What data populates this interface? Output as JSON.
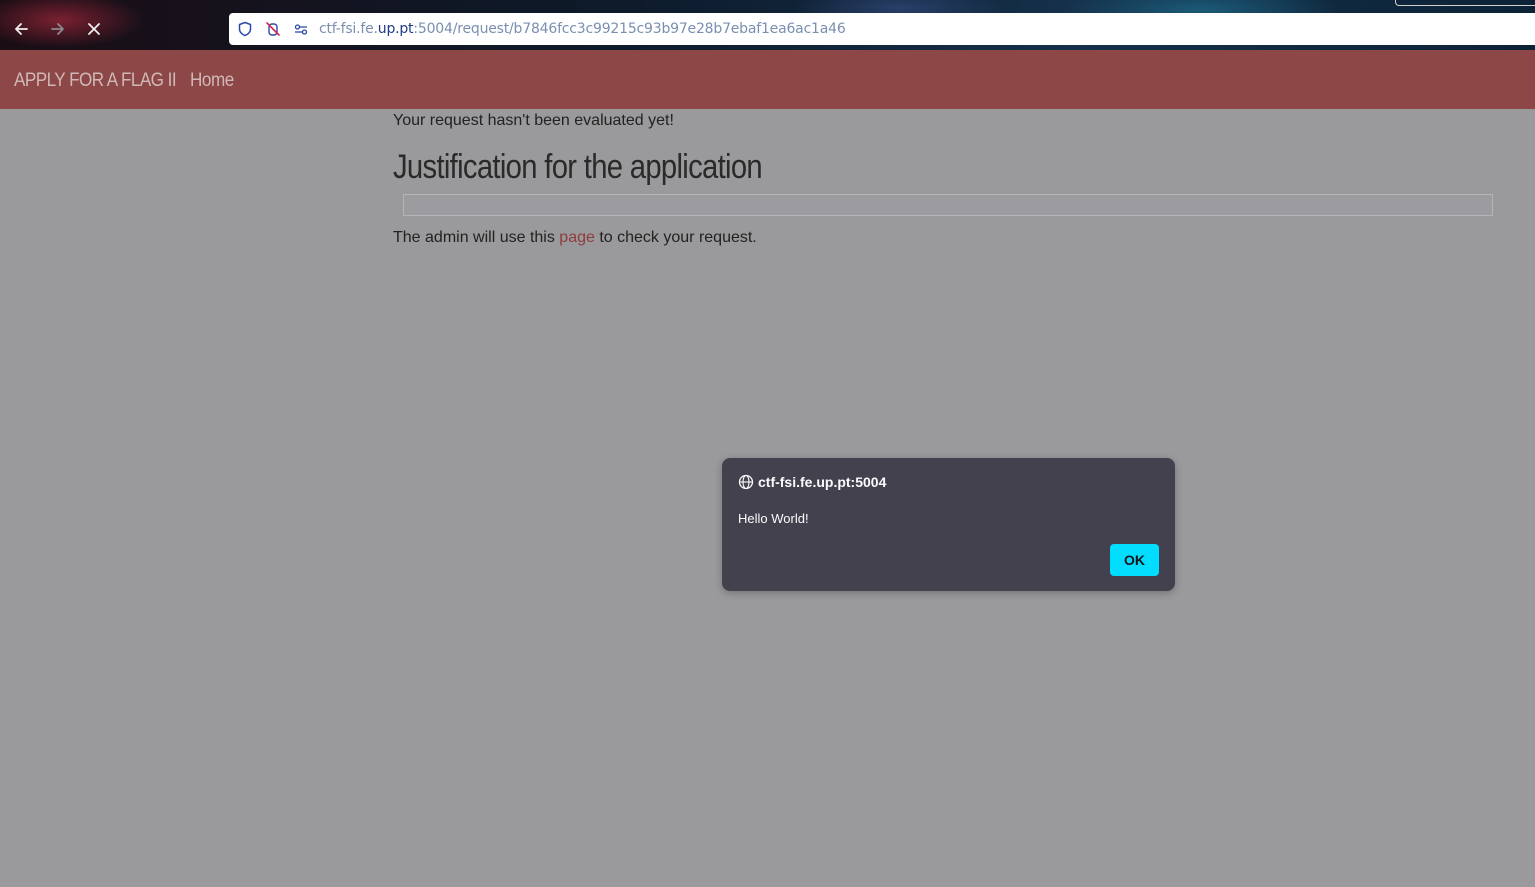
{
  "browser": {
    "url_prefix": "ctf-fsi.fe.",
    "url_host": "up.pt",
    "url_suffix": ":5004/request/b7846fcc3c99215c93b97e28b7ebaf1ea6ac1a46"
  },
  "navbar": {
    "brand": "APPLY FOR A FLAG II",
    "home": "Home"
  },
  "content": {
    "status": "Your request hasn't been evaluated yet!",
    "heading": "Justification for the application",
    "justification": "",
    "admin_before": "The admin will use this ",
    "admin_link": "page",
    "admin_after": " to check your request."
  },
  "dialog": {
    "origin": "ctf-fsi.fe.up.pt:5004",
    "message": "Hello World!",
    "ok_label": "OK"
  },
  "colors": {
    "navbar": "#8e4747",
    "page_background": "#9a9a9c",
    "dialog_background": "#42414d",
    "ok_button": "#00ddff",
    "link": "#8e3d3d"
  },
  "icons": {
    "back": "arrow-left-icon",
    "forward": "arrow-right-icon",
    "stop": "close-icon",
    "shield": "shield-icon",
    "permissions": "camera-off-icon",
    "site_info": "sliders-icon",
    "dialog_origin": "globe-icon"
  }
}
